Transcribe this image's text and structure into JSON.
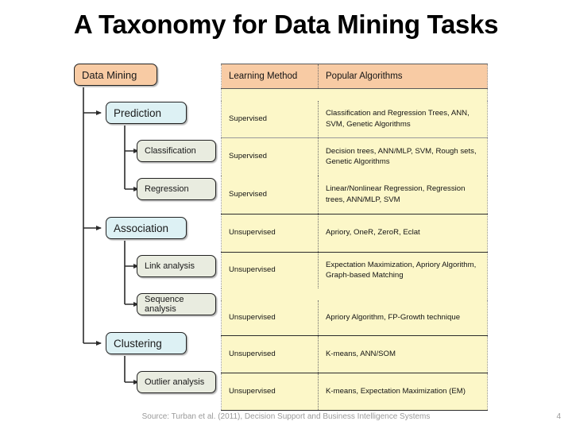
{
  "slide": {
    "title": "A Taxonomy for Data Mining Tasks",
    "page_number": "4",
    "source": "Source: Turban et al. (2011), Decision Support and Business Intelligence Systems"
  },
  "colors": {
    "header_peach": "#f8cba4",
    "row_yellow": "#fcf7c8",
    "level1_cyan": "#ddf1f4",
    "level2_sage": "#e9ece0",
    "outline": "#222222",
    "footer_gray": "#9a9a9a"
  },
  "tree": {
    "root": {
      "label": "Data Mining"
    },
    "branches": [
      {
        "label": "Prediction",
        "children": [
          {
            "label": "Classification"
          },
          {
            "label": "Regression"
          }
        ]
      },
      {
        "label": "Association",
        "children": [
          {
            "label": "Link analysis"
          },
          {
            "label": "Sequence analysis"
          }
        ]
      },
      {
        "label": "Clustering",
        "children": [
          {
            "label": "Outlier analysis"
          }
        ]
      }
    ]
  },
  "table": {
    "headers": [
      "Learning Method",
      "Popular Algorithms"
    ],
    "rows": [
      {
        "learning_method": "Supervised",
        "algorithms": "Classification and Regression Trees, ANN, SVM, Genetic Algorithms"
      },
      {
        "learning_method": "Supervised",
        "algorithms": "Decision trees, ANN/MLP, SVM, Rough sets, Genetic Algorithms"
      },
      {
        "learning_method": "Supervised",
        "algorithms": "Linear/Nonlinear Regression, Regression trees, ANN/MLP, SVM"
      },
      {
        "learning_method": "Unsupervised",
        "algorithms": "Apriory, OneR, ZeroR, Eclat"
      },
      {
        "learning_method": "Unsupervised",
        "algorithms": "Expectation Maximization, Apriory Algorithm, Graph-based Matching"
      },
      {
        "learning_method": "Unsupervised",
        "algorithms": "Apriory Algorithm, FP-Growth technique"
      },
      {
        "learning_method": "Unsupervised",
        "algorithms": "K-means, ANN/SOM"
      },
      {
        "learning_method": "Unsupervised",
        "algorithms": "K-means, Expectation Maximization (EM)"
      }
    ]
  }
}
